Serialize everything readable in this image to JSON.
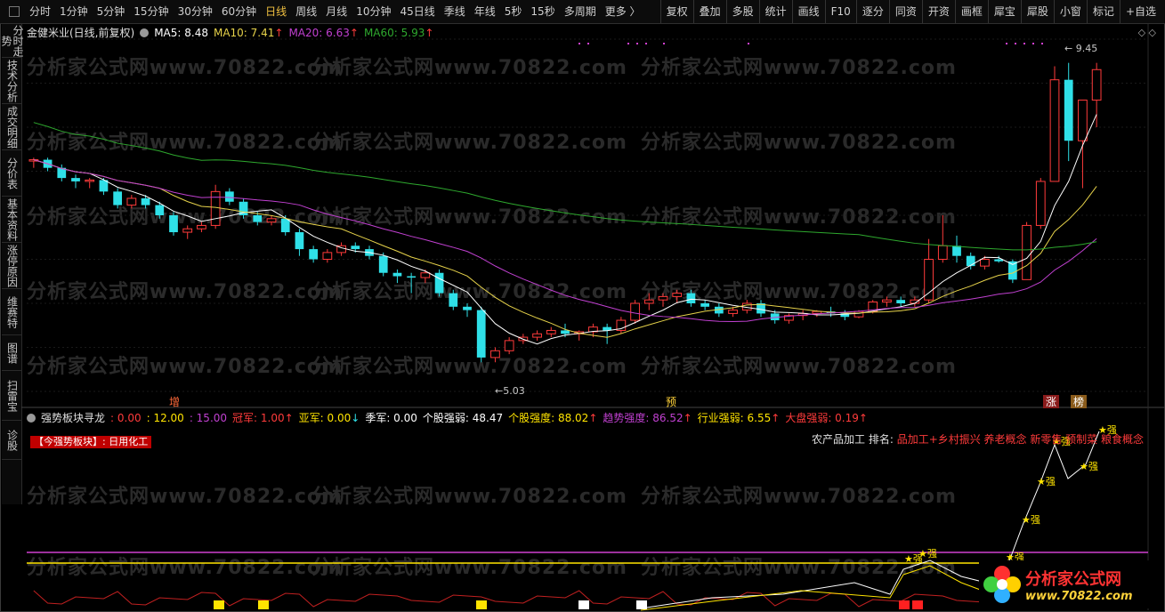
{
  "toolbar": {
    "periods": [
      "分时",
      "1分钟",
      "5分钟",
      "15分钟",
      "30分钟",
      "60分钟",
      "日线",
      "周线",
      "月线",
      "10分钟",
      "45日线",
      "季线",
      "年线",
      "5秒",
      "15秒",
      "多周期",
      "更多 〉"
    ],
    "active": "日线",
    "tools": [
      "复权",
      "叠加",
      "多股",
      "统计",
      "画线",
      "F10",
      "逐分",
      "同资",
      "开资",
      "画框",
      "犀宝",
      "犀股",
      "小窗",
      "标记",
      "+自选"
    ]
  },
  "sidebar": {
    "items": [
      "分时走势",
      "技术分析",
      "成交明细",
      "分价表",
      "基本资料",
      "涨停原因",
      "维赛特",
      "图谱",
      "扫雷宝",
      "诊股"
    ]
  },
  "main_legend": {
    "title": "金健米业(日线,前复权)",
    "ma5": "MA5: 8.48",
    "ma10": "MA10: 7.41",
    "ma20": "MA20: 6.63",
    "ma60": "MA60: 5.93",
    "arrow": "↑"
  },
  "top_icons": "◇  ◇",
  "indicator": {
    "name": "强势板块寻龙",
    "v1": ": 0.00",
    "v2": ": 12.00",
    "v3": ": 15.00",
    "guanjun": "冠军: 1.00",
    "yajun": "亚军: 0.00",
    "jijun": "季军: 0.00",
    "gegu_label": "个股强弱: 48.47",
    "gegu_qiangdu": "个股强度: 88.02",
    "qushi": "趋势强度: 86.52",
    "hangye": "行业强弱: 6.55",
    "dapan": "大盘强弱: 0.19",
    "up": "↑",
    "down": "↓"
  },
  "sector_tag": "【今强势板块】: 日用化工",
  "info_line": {
    "prefix": "农产品加工  排名: ",
    "tags": "品加工+乡村振兴 养老概念 新零售 预制菜 粮食概念"
  },
  "annotations": {
    "low": "←5.03",
    "high": "← 9.45",
    "zeng": "增",
    "yu": "预",
    "zhang": "涨",
    "bang": "榜",
    "qiang": "★强"
  },
  "watermark": "分析家公式网www.70822.com",
  "logo": {
    "line1": "分析家公式网",
    "line2": "www.70822.com"
  },
  "colors": {
    "up": "#ff3b3b",
    "down": "#2fe0e8",
    "ma5": "#ffffff",
    "ma10": "#e6d24a",
    "ma20": "#c040d0",
    "ma60": "#2ea82e",
    "yellow": "#ffe400",
    "magenta": "#d040d0",
    "accent": "#f0c040"
  },
  "chart_data": {
    "type": "candlestick",
    "ohlc": [
      [
        8.0,
        8.05,
        7.9,
        8.02
      ],
      [
        8.02,
        8.05,
        7.85,
        7.9
      ],
      [
        7.9,
        7.95,
        7.7,
        7.75
      ],
      [
        7.75,
        7.8,
        7.6,
        7.7
      ],
      [
        7.7,
        7.75,
        7.6,
        7.72
      ],
      [
        7.72,
        7.75,
        7.5,
        7.55
      ],
      [
        7.55,
        7.6,
        7.3,
        7.35
      ],
      [
        7.35,
        7.5,
        7.3,
        7.45
      ],
      [
        7.45,
        7.5,
        7.3,
        7.35
      ],
      [
        7.35,
        7.4,
        7.15,
        7.2
      ],
      [
        7.2,
        7.25,
        6.9,
        6.95
      ],
      [
        6.95,
        7.05,
        6.85,
        7.0
      ],
      [
        7.0,
        7.1,
        6.95,
        7.05
      ],
      [
        7.05,
        7.65,
        7.0,
        7.55
      ],
      [
        7.55,
        7.6,
        7.35,
        7.4
      ],
      [
        7.4,
        7.45,
        7.15,
        7.2
      ],
      [
        7.2,
        7.25,
        7.05,
        7.1
      ],
      [
        7.1,
        7.2,
        7.05,
        7.15
      ],
      [
        7.15,
        7.2,
        6.9,
        6.95
      ],
      [
        6.95,
        7.0,
        6.6,
        6.7
      ],
      [
        6.7,
        6.75,
        6.5,
        6.55
      ],
      [
        6.55,
        6.7,
        6.5,
        6.65
      ],
      [
        6.65,
        6.8,
        6.6,
        6.75
      ],
      [
        6.75,
        6.8,
        6.65,
        6.7
      ],
      [
        6.7,
        6.75,
        6.55,
        6.6
      ],
      [
        6.6,
        6.65,
        6.3,
        6.35
      ],
      [
        6.35,
        6.4,
        6.2,
        6.3
      ],
      [
        6.3,
        6.35,
        6.05,
        6.28
      ],
      [
        6.28,
        6.4,
        6.2,
        6.35
      ],
      [
        6.35,
        6.4,
        6.0,
        6.05
      ],
      [
        6.05,
        6.1,
        5.8,
        5.85
      ],
      [
        5.85,
        5.9,
        5.7,
        5.8
      ],
      [
        5.8,
        5.85,
        5.03,
        5.1
      ],
      [
        5.1,
        5.25,
        5.03,
        5.2
      ],
      [
        5.2,
        5.4,
        5.15,
        5.35
      ],
      [
        5.35,
        5.45,
        5.3,
        5.4
      ],
      [
        5.4,
        5.5,
        5.35,
        5.45
      ],
      [
        5.45,
        5.55,
        5.4,
        5.5
      ],
      [
        5.5,
        5.6,
        5.4,
        5.45
      ],
      [
        5.45,
        5.5,
        5.35,
        5.48
      ],
      [
        5.48,
        5.6,
        5.4,
        5.55
      ],
      [
        5.55,
        5.6,
        5.3,
        5.5
      ],
      [
        5.5,
        5.7,
        5.45,
        5.65
      ],
      [
        5.65,
        5.95,
        5.6,
        5.9
      ],
      [
        5.9,
        6.05,
        5.8,
        5.95
      ],
      [
        5.95,
        6.05,
        5.85,
        6.0
      ],
      [
        6.0,
        6.1,
        5.9,
        6.05
      ],
      [
        6.05,
        6.1,
        5.85,
        5.9
      ],
      [
        5.9,
        5.95,
        5.8,
        5.85
      ],
      [
        5.85,
        5.9,
        5.7,
        5.75
      ],
      [
        5.75,
        5.85,
        5.7,
        5.8
      ],
      [
        5.8,
        5.95,
        5.75,
        5.9
      ],
      [
        5.9,
        5.95,
        5.7,
        5.75
      ],
      [
        5.75,
        5.8,
        5.6,
        5.65
      ],
      [
        5.65,
        5.75,
        5.6,
        5.72
      ],
      [
        5.72,
        5.8,
        5.65,
        5.75
      ],
      [
        5.75,
        5.8,
        5.7,
        5.78
      ],
      [
        5.78,
        5.85,
        5.7,
        5.75
      ],
      [
        5.75,
        5.8,
        5.65,
        5.7
      ],
      [
        5.7,
        5.8,
        5.68,
        5.78
      ],
      [
        5.78,
        5.95,
        5.75,
        5.92
      ],
      [
        5.92,
        6.0,
        5.85,
        5.95
      ],
      [
        5.95,
        6.0,
        5.85,
        5.9
      ],
      [
        5.9,
        6.0,
        5.85,
        5.95
      ],
      [
        5.95,
        6.85,
        5.9,
        6.55
      ],
      [
        6.55,
        7.2,
        6.5,
        6.75
      ],
      [
        6.75,
        6.9,
        6.5,
        6.6
      ],
      [
        6.6,
        6.65,
        6.4,
        6.45
      ],
      [
        6.45,
        6.6,
        6.4,
        6.55
      ],
      [
        6.55,
        6.6,
        6.5,
        6.52
      ],
      [
        6.52,
        6.55,
        6.2,
        6.25
      ],
      [
        6.25,
        7.1,
        6.25,
        7.05
      ],
      [
        7.05,
        7.75,
        7.0,
        7.7
      ],
      [
        7.7,
        9.4,
        7.7,
        9.2
      ],
      [
        9.2,
        9.45,
        8.0,
        8.3
      ],
      [
        8.3,
        8.9,
        7.6,
        8.9
      ],
      [
        8.9,
        9.45,
        8.5,
        9.35
      ]
    ],
    "ylim": [
      4.6,
      9.8
    ],
    "high_label": 9.45,
    "low_label": 5.03
  }
}
